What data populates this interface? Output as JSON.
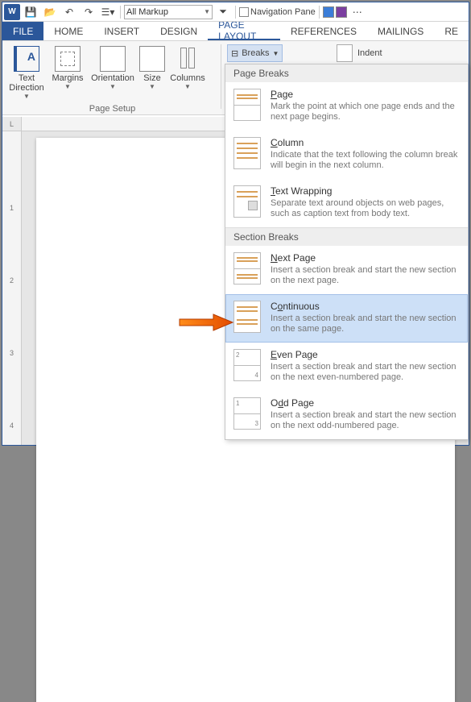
{
  "qat": {
    "markup": "All Markup",
    "navpane": "Navigation Pane"
  },
  "tabs": [
    "FILE",
    "HOME",
    "INSERT",
    "DESIGN",
    "PAGE LAYOUT",
    "REFERENCES",
    "MAILINGS",
    "RE"
  ],
  "ribbon": {
    "text_direction": "Text Direction",
    "margins": "Margins",
    "orientation": "Orientation",
    "size": "Size",
    "columns": "Columns",
    "group_label": "Page Setup",
    "breaks": "Breaks",
    "indent": "Indent"
  },
  "menu": {
    "header1": "Page Breaks",
    "header2": "Section Breaks",
    "items": [
      {
        "u": "P",
        "rest": "age",
        "desc": "Mark the point at which one page ends and the next page begins."
      },
      {
        "u": "C",
        "rest": "olumn",
        "desc": "Indicate that the text following the column break will begin in the next column."
      },
      {
        "u": "T",
        "rest": "ext Wrapping",
        "desc": "Separate text around objects on web pages, such as caption text from body text."
      },
      {
        "u": "N",
        "rest": "ext Page",
        "desc": "Insert a section break and start the new section on the next page."
      },
      {
        "u": "o",
        "rest": "ntinuous",
        "desc": "Insert a section break and start the new section on the same page."
      },
      {
        "u": "E",
        "rest": "ven Page",
        "desc": "Insert a section break and start the new section on the next even-numbered page."
      },
      {
        "u": "d",
        "rest": "d Page",
        "desc": "Insert a section break and start the new section on the next odd-numbered page."
      }
    ]
  },
  "ruler": {
    "ticks": [
      "1",
      "2",
      "3",
      "4"
    ]
  }
}
